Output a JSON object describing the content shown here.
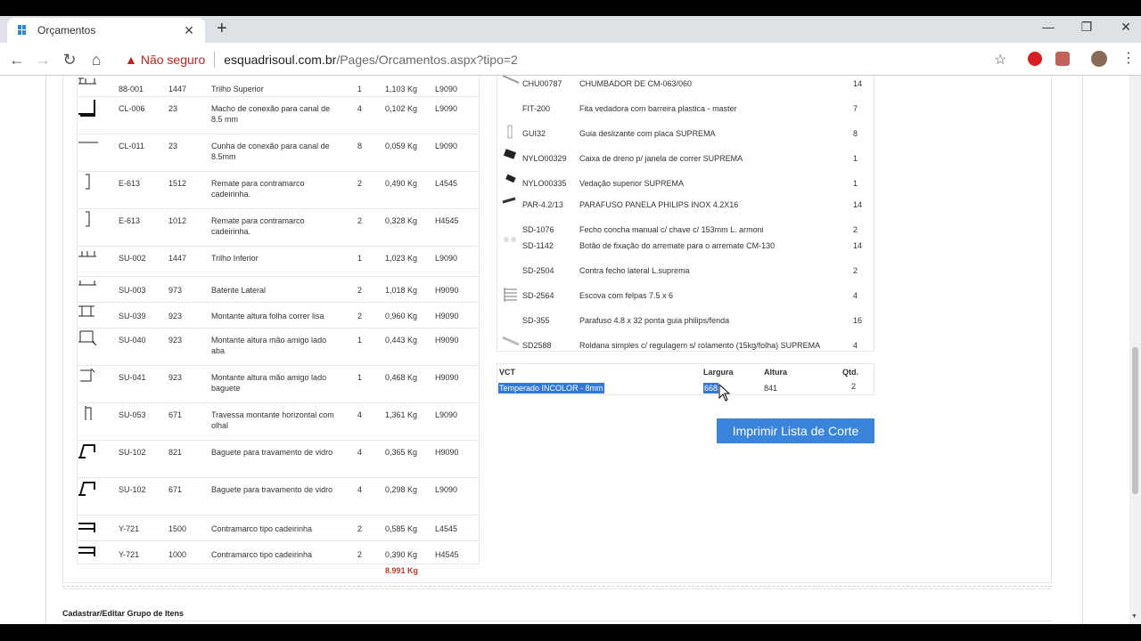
{
  "browser": {
    "tab_title": "Orçamentos",
    "security_label": "Não seguro",
    "url_host": "esquadrisoul.com.br",
    "url_path": "/Pages/Orcamentos.aspx?tipo=2"
  },
  "profiles": {
    "total_weight": "8.991 Kg",
    "rows": [
      {
        "code": "88-001",
        "size": "1447",
        "desc": "Trilho Superior",
        "qty": "1",
        "weight": "1,103 Kg",
        "finish": "L9090"
      },
      {
        "code": "CL-006",
        "size": "23",
        "desc": "Macho de conexão para canal de 8.5 mm",
        "qty": "4",
        "weight": "0,102 Kg",
        "finish": "L9090"
      },
      {
        "code": "CL-011",
        "size": "23",
        "desc": "Cunha de conexão para canal de 8.5mm",
        "qty": "8",
        "weight": "0,059 Kg",
        "finish": "L9090"
      },
      {
        "code": "E-613",
        "size": "1512",
        "desc": "Remate para contramarco cadeirinha.",
        "qty": "2",
        "weight": "0,490 Kg",
        "finish": "L4545"
      },
      {
        "code": "E-613",
        "size": "1012",
        "desc": "Remate para contramarco cadeirinha.",
        "qty": "2",
        "weight": "0,328 Kg",
        "finish": "H4545"
      },
      {
        "code": "SU-002",
        "size": "1447",
        "desc": "Trilho Inferior",
        "qty": "1",
        "weight": "1,023 Kg",
        "finish": "L9090"
      },
      {
        "code": "SU-003",
        "size": "973",
        "desc": "Batente Lateral",
        "qty": "2",
        "weight": "1,018 Kg",
        "finish": "H9090"
      },
      {
        "code": "SU-039",
        "size": "923",
        "desc": "Montante altura folha correr lisa",
        "qty": "2",
        "weight": "0,960 Kg",
        "finish": "H9090"
      },
      {
        "code": "SU-040",
        "size": "923",
        "desc": "Montante altura mão amigo lado aba",
        "qty": "1",
        "weight": "0,443 Kg",
        "finish": "H9090"
      },
      {
        "code": "SU-041",
        "size": "923",
        "desc": "Montante altura mão amigo lado baguete",
        "qty": "1",
        "weight": "0,468 Kg",
        "finish": "H9090"
      },
      {
        "code": "SU-053",
        "size": "671",
        "desc": "Travessa montante horizontal com olhal",
        "qty": "4",
        "weight": "1,361 Kg",
        "finish": "L9090"
      },
      {
        "code": "SU-102",
        "size": "821",
        "desc": "Baguete para travamento de vidro",
        "qty": "4",
        "weight": "0,365 Kg",
        "finish": "H9090"
      },
      {
        "code": "SU-102",
        "size": "671",
        "desc": "Baguete para travamento de vidro",
        "qty": "4",
        "weight": "0,298 Kg",
        "finish": "L9090"
      },
      {
        "code": "Y-721",
        "size": "1500",
        "desc": "Contramarco tipo cadeirinha",
        "qty": "2",
        "weight": "0,585 Kg",
        "finish": "L4545"
      },
      {
        "code": "Y-721",
        "size": "1000",
        "desc": "Contramarco tipo cadeirinha",
        "qty": "2",
        "weight": "0,390 Kg",
        "finish": "H4545"
      }
    ]
  },
  "accessories": {
    "rows": [
      {
        "code": "CHU00787",
        "desc": "CHUMBADOR DE CM-063/060",
        "qty": "14"
      },
      {
        "code": "FIT-200",
        "desc": "Fita vedadora com barreira plastica - master",
        "qty": "7"
      },
      {
        "code": "GUI32",
        "desc": "Guia deslizante com placa SUPREMA",
        "qty": "8"
      },
      {
        "code": "NYLO00329",
        "desc": "Caixa de dreno p/ janela de correr SUPREMA",
        "qty": "1"
      },
      {
        "code": "NYLO00335",
        "desc": "Vedação superior SUPREMA",
        "qty": "1"
      },
      {
        "code": "PAR-4.2/13",
        "desc": "PARAFUSO PANELA PHILIPS INOX 4.2X16",
        "qty": "14"
      },
      {
        "code": "SD-1076",
        "desc": "Fecho concha manual c/ chave c/ 153mm L. armoni",
        "qty": "2"
      },
      {
        "code": "SD-1142",
        "desc": "Botão de fixação do arremate para o arremate CM-130",
        "qty": "14"
      },
      {
        "code": "SD-2504",
        "desc": "Contra fecho lateral L.suprema",
        "qty": "2"
      },
      {
        "code": "SD-2564",
        "desc": "Escova com felpas 7.5 x 6",
        "qty": "4"
      },
      {
        "code": "SD-355",
        "desc": "Parafuso 4.8 x 32 ponta guia philips/fenda",
        "qty": "16"
      },
      {
        "code": "SD2588",
        "desc": "Roldana simples c/ regulagem s/ rolamento (15kg/folha) SUPREMA",
        "qty": "4"
      }
    ]
  },
  "glass": {
    "header_vct": "VCT",
    "header_width": "Largura",
    "header_height": "Altura",
    "header_qty": "Qtd.",
    "type": "Temperado INCOLOR - 8mm",
    "width": "668",
    "height": "841",
    "qty": "2"
  },
  "print_button": "Imprimir Lista de Corte",
  "section_title": "Cadastrar/Editar Grupo de Itens"
}
